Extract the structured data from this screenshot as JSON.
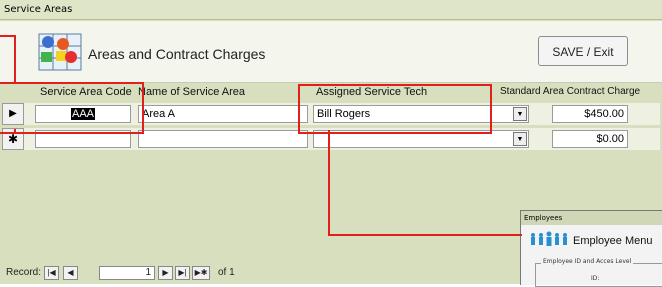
{
  "window": {
    "title": "Service Areas"
  },
  "header": {
    "title": "Areas and Contract Charges",
    "save_label": "SAVE / Exit"
  },
  "columns": {
    "code": "Service Area Code",
    "name": "Name of Service Area",
    "tech": "Assigned Service Tech",
    "charge": "Standard Area Contract Charge"
  },
  "rows": [
    {
      "code": "AAA",
      "name": "Area A",
      "tech": "Bill Rogers",
      "charge": "$450.00"
    },
    {
      "code": "",
      "name": "",
      "tech": "",
      "charge": "$0.00"
    }
  ],
  "record_nav": {
    "label": "Record:",
    "current": "1",
    "of_label": "of 1"
  },
  "employees_window": {
    "title": "Employees",
    "menu_title": "Employee Menu",
    "frame_label": "Employee ID and Acces Level",
    "id_label": "ID:"
  },
  "colors": {
    "callout": "#e0201c",
    "form_bg": "#d8dfbe",
    "header_bg": "#f4f5ec"
  },
  "icons": {
    "logo": "grid-shapes-icon",
    "row_selector": "record-selector-icon",
    "new_record": "new-record-asterisk-icon",
    "employee": "people-group-icon"
  }
}
